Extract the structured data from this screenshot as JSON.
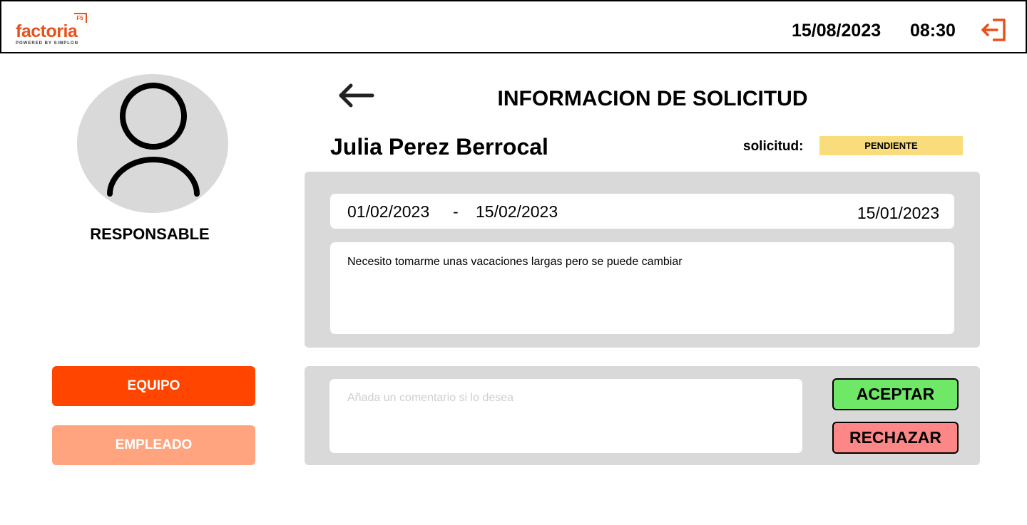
{
  "header": {
    "logo": {
      "name": "factoria",
      "badge": "F5",
      "tagline": "POWERED BY SIMPLON"
    },
    "date": "15/08/2023",
    "time": "08:30",
    "logout_icon": "logout-icon"
  },
  "profile": {
    "avatar_icon": "user-icon",
    "role": "RESPONSABLE"
  },
  "nav": {
    "equipo": "EQUIPO",
    "empleado": "EMPLEADO"
  },
  "request": {
    "back_icon": "arrow-left-icon",
    "title": "INFORMACION DE SOLICITUD",
    "employee_name": "Julia Perez Berrocal",
    "status_label": "solicitud:",
    "status": "PENDIENTE",
    "start_date": "01/02/2023",
    "separator": "-",
    "end_date": "15/02/2023",
    "request_date": "15/01/2023",
    "reason": "Necesito tomarme unas vacaciones largas pero se puede cambiar"
  },
  "actions": {
    "comment_placeholder": "Añada un comentario si lo desea",
    "accept": "ACEPTAR",
    "reject": "RECHAZAR"
  },
  "colors": {
    "brand": "#e8501c",
    "primary_button": "#ff4500",
    "secondary_button": "#ffa47f",
    "status_pending": "#f9dc7b",
    "accept": "#6ee866",
    "reject": "#fd8787",
    "panel": "#d9d9d9"
  }
}
